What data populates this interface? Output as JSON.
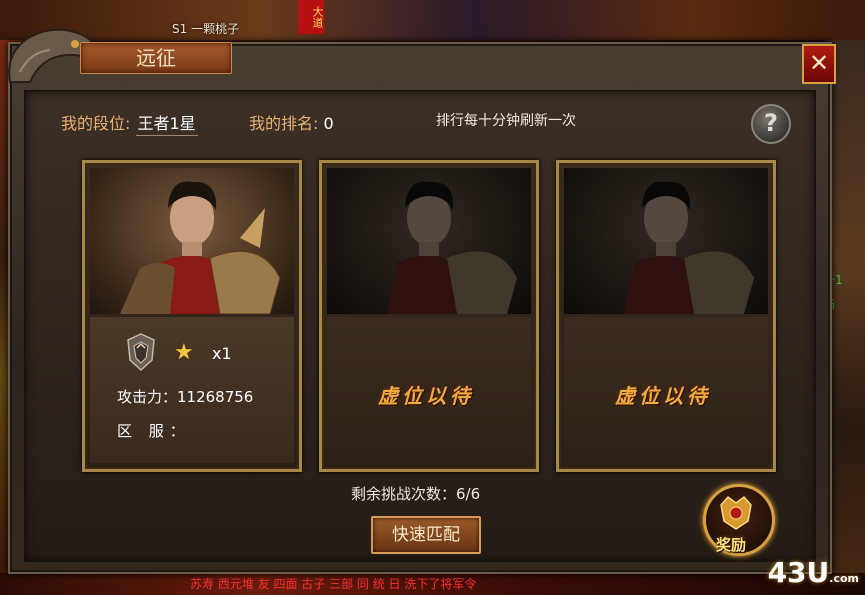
{
  "background": {
    "player_name": "S1 一颗桃子",
    "banner_text": "大道",
    "right_text": "升1 伤",
    "bottom_text": "苏寿 西元堆 友 四面 古子 三部 同 统 日 洗下了将军令"
  },
  "window": {
    "title": "远征",
    "close_label": "✕"
  },
  "info": {
    "segment_label": "我的段位:",
    "segment_value": "王者1星",
    "rank_label": "我的排名:",
    "rank_value": "0",
    "refresh_note": "排行每十分钟刷新一次",
    "help_label": "?"
  },
  "player_card": {
    "star_count": "x1",
    "attack_label": "攻击力：11268756",
    "server_label": "区 服："
  },
  "empty_cards": [
    {
      "label": "虚位以待"
    },
    {
      "label": "虚位以待"
    }
  ],
  "footer": {
    "remaining": "剩余挑战次数：6/6",
    "match_button": "快速匹配",
    "reward_label": "奖励"
  },
  "watermark": {
    "main": "43U",
    "suffix": ".com"
  },
  "colors": {
    "gold_border": "#a8884a",
    "accent_text": "#e8b070",
    "vacant_text": "#f0a840",
    "close_red": "#b01a10"
  }
}
